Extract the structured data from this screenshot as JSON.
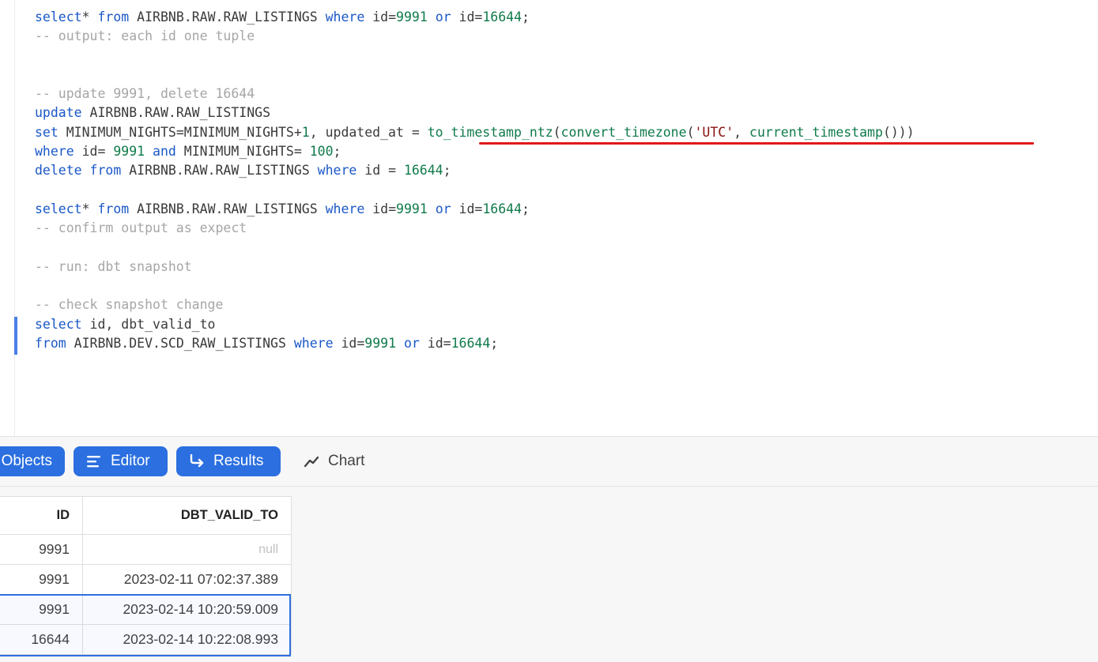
{
  "editor": {
    "lines": [
      [
        [
          "kw",
          "select"
        ],
        [
          "",
          "* "
        ],
        [
          "kw",
          "from"
        ],
        [
          "",
          " AIRBNB.RAW.RAW_LISTINGS "
        ],
        [
          "kw",
          "where"
        ],
        [
          "",
          " id="
        ],
        [
          "num",
          "9991"
        ],
        [
          "",
          " "
        ],
        [
          "kw",
          "or"
        ],
        [
          "",
          " id="
        ],
        [
          "num",
          "16644"
        ],
        [
          "",
          ";"
        ]
      ],
      [
        [
          "cm",
          "-- output: each id one tuple"
        ]
      ],
      [],
      [],
      [
        [
          "cm",
          "-- update 9991, delete 16644"
        ]
      ],
      [
        [
          "kw",
          "update"
        ],
        [
          "",
          " AIRBNB.RAW.RAW_LISTINGS"
        ]
      ],
      [
        [
          "kw",
          "set"
        ],
        [
          "",
          " MINIMUM_NIGHTS=MINIMUM_NIGHTS+"
        ],
        [
          "num",
          "1"
        ],
        [
          "",
          ", updated_at = "
        ],
        [
          "fn",
          "to_timestamp_ntz"
        ],
        [
          "",
          "("
        ],
        [
          "fn",
          "convert_timezone"
        ],
        [
          "",
          "("
        ],
        [
          "str",
          "'UTC'"
        ],
        [
          "",
          ", "
        ],
        [
          "fn",
          "current_timestamp"
        ],
        [
          "",
          "()))"
        ]
      ],
      [
        [
          "kw",
          "where"
        ],
        [
          "",
          " id= "
        ],
        [
          "num",
          "9991"
        ],
        [
          "",
          " "
        ],
        [
          "kw",
          "and"
        ],
        [
          "",
          " MINIMUM_NIGHTS= "
        ],
        [
          "num",
          "100"
        ],
        [
          "",
          ";"
        ]
      ],
      [
        [
          "kw",
          "delete"
        ],
        [
          "",
          " "
        ],
        [
          "kw",
          "from"
        ],
        [
          "",
          " AIRBNB.RAW.RAW_LISTINGS "
        ],
        [
          "kw",
          "where"
        ],
        [
          "",
          " id = "
        ],
        [
          "num",
          "16644"
        ],
        [
          "",
          ";"
        ]
      ],
      [],
      [
        [
          "kw",
          "select"
        ],
        [
          "",
          "* "
        ],
        [
          "kw",
          "from"
        ],
        [
          "",
          " AIRBNB.RAW.RAW_LISTINGS "
        ],
        [
          "kw",
          "where"
        ],
        [
          "",
          " id="
        ],
        [
          "num",
          "9991"
        ],
        [
          "",
          " "
        ],
        [
          "kw",
          "or"
        ],
        [
          "",
          " id="
        ],
        [
          "num",
          "16644"
        ],
        [
          "",
          ";"
        ]
      ],
      [
        [
          "cm",
          "-- confirm output as expect"
        ]
      ],
      [],
      [
        [
          "cm",
          "-- run: dbt snapshot"
        ]
      ],
      [],
      [
        [
          "cm",
          "-- check snapshot change"
        ]
      ],
      [
        [
          "kw",
          "select"
        ],
        [
          "",
          " id, dbt_valid_to"
        ]
      ],
      [
        [
          "kw",
          "from"
        ],
        [
          "",
          " AIRBNB.DEV.SCD_RAW_LISTINGS "
        ],
        [
          "kw",
          "where"
        ],
        [
          "",
          " id="
        ],
        [
          "num",
          "9991"
        ],
        [
          "",
          " "
        ],
        [
          "kw",
          "or"
        ],
        [
          "",
          " id="
        ],
        [
          "num",
          "16644"
        ],
        [
          "",
          ";"
        ]
      ]
    ]
  },
  "toolbar": {
    "objects_label": "Objects",
    "editor_label": "Editor",
    "results_label": "Results",
    "chart_label": "Chart"
  },
  "results": {
    "columns": [
      "ID",
      "DBT_VALID_TO"
    ],
    "rows": [
      {
        "id": "9991",
        "dbt_valid_to": "null"
      },
      {
        "id": "9991",
        "dbt_valid_to": "2023-02-11 07:02:37.389"
      },
      {
        "id": "9991",
        "dbt_valid_to": "2023-02-14 10:20:59.009"
      },
      {
        "id": "16644",
        "dbt_valid_to": "2023-02-14 10:22:08.993"
      }
    ]
  },
  "colors": {
    "keyword": "#1a58c8",
    "number": "#0f7a4a",
    "string": "#8a1010",
    "comment": "#a6a6a6",
    "accent": "#2b6fe0",
    "annotation": "#e01818"
  },
  "icons": {
    "editor": "editor-lines-icon",
    "results": "results-arrow-icon",
    "chart": "chart-line-icon"
  }
}
